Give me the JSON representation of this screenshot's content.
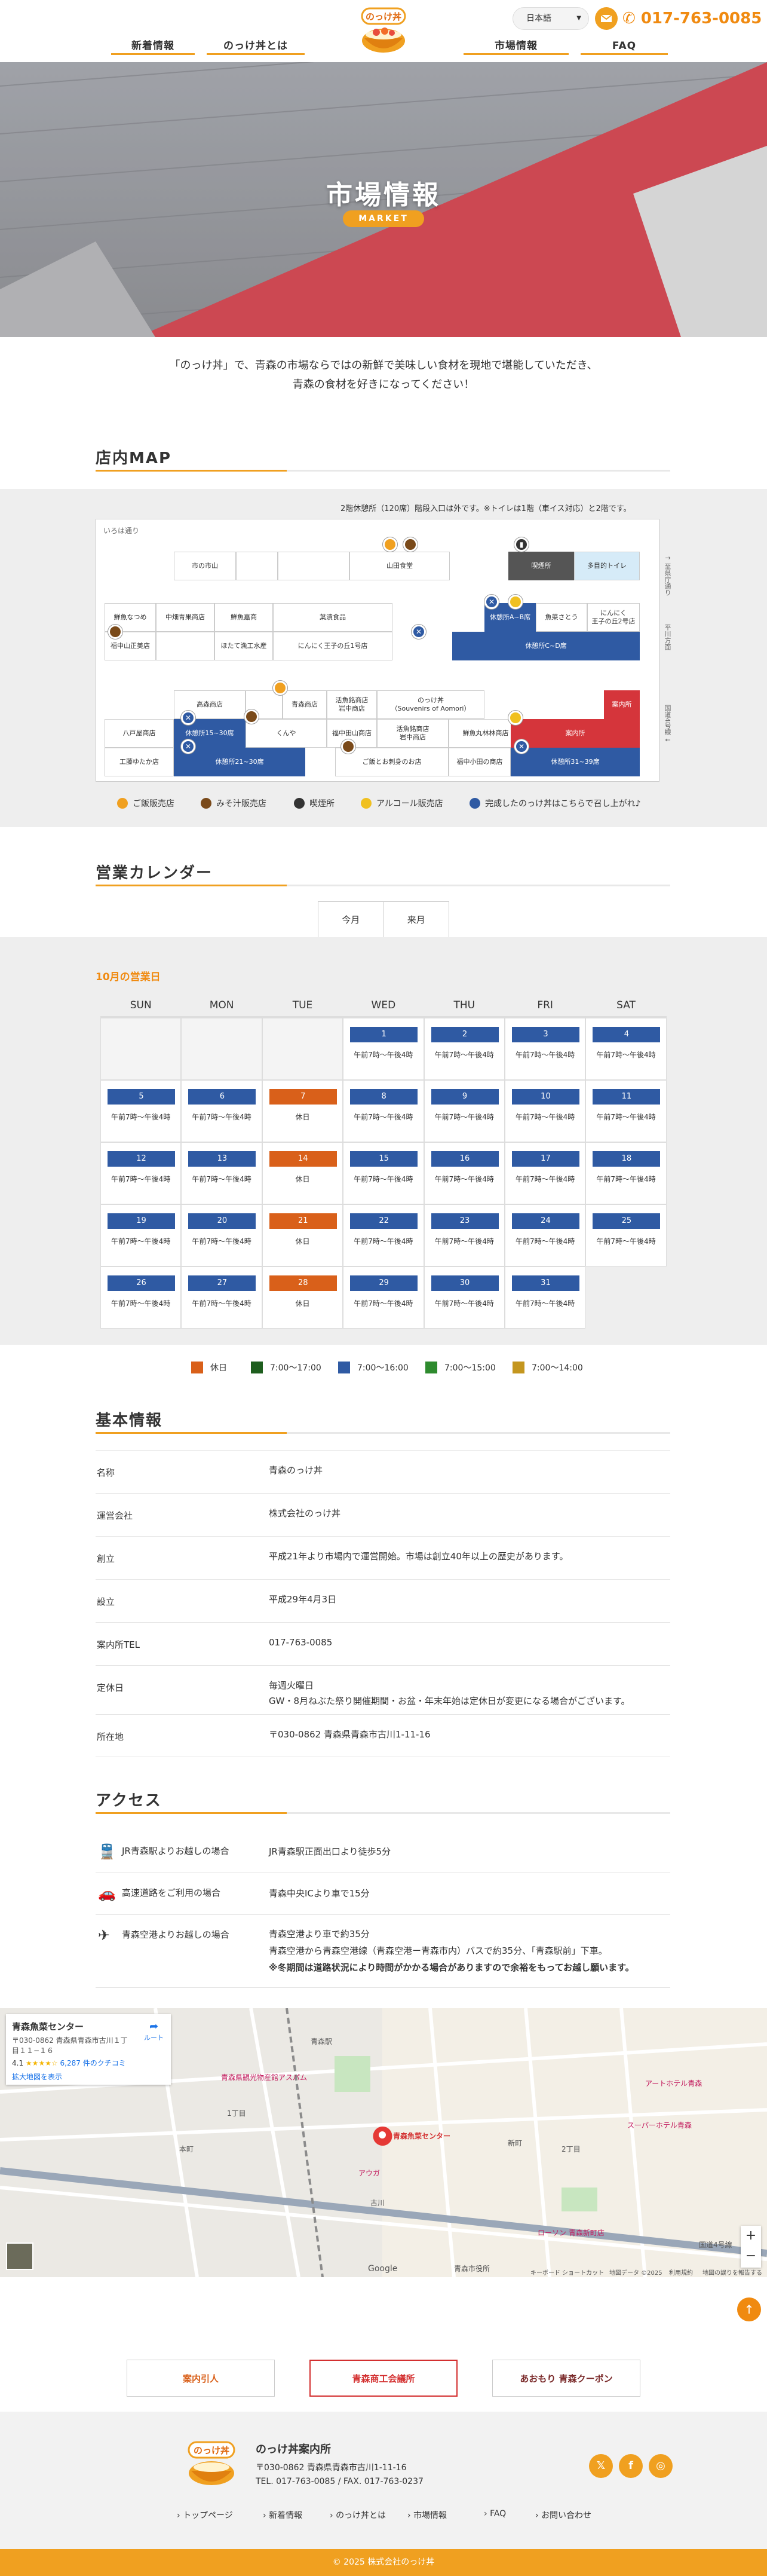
{
  "header": {
    "nav": [
      "新着情報",
      "のっけ丼とは",
      "市場情報",
      "FAQ"
    ],
    "lang": "日本語",
    "tel": "017-763-0085",
    "logo_text": "のっけ丼"
  },
  "hero": {
    "title": "市場情報",
    "badge": "MARKET"
  },
  "intro": {
    "line1": "「のっけ丼」で、青森の市場ならではの新鮮で美味しい食材を現地で堪能していただき、",
    "line2": "青森の食材を好きになってください！"
  },
  "store_map": {
    "title": "店内MAP",
    "note": "2階休憩所（120席）階段入口は外です。※トイレは1階（車イス対応）と2階です。",
    "road_top": "いろは通り",
    "road_right1": "↑ 至県庁通り",
    "road_right2": "平川方面",
    "road_right3": "国道4号線 ↓",
    "cells": [
      "市の市山",
      "山田食堂",
      "喫煙所",
      "多目的トイレ",
      "鮮魚なつめ",
      "中畑青果商店",
      "鮮魚嘉商",
      "葉漬食品",
      "休憩所A~B席",
      "魚菜さとう",
      "にんにく\n王子の丘2号店",
      "福中山正美店",
      "ほたて漁工水産",
      "にんにく王子の丘1号店",
      "休憩所C~D席",
      "高森商店",
      "青森商店",
      "活魚銘商店\n岩中商店",
      "のっけ丼\n（Souvenirs of Aomori）",
      "案内所",
      "八戸屋商店",
      "休憩所15~30席",
      "くんや",
      "福中田山商店",
      "活魚銘商店\n岩中商店",
      "鮮魚丸林林商店",
      "工藤ゆたか店",
      "休憩所21~30席",
      "ご飯とお刺身のお店",
      "福中小田の商店",
      "休憩所31~39席"
    ],
    "legend": [
      "ご飯販売店",
      "みそ汁販売店",
      "喫煙所",
      "アルコール販売店",
      "完成したのっけ丼はこちらで召し上がれ♪"
    ]
  },
  "calendar": {
    "title": "営業カレンダー",
    "tabs": [
      "今月",
      "来月"
    ],
    "month_title": "10月の営業日",
    "weekdays": [
      "SUN",
      "MON",
      "TUE",
      "WED",
      "THU",
      "FRI",
      "SAT"
    ],
    "days": [
      {
        "d": "1",
        "h": "午前7時〜午後4時",
        "c": "#2f5aa3"
      },
      {
        "d": "2",
        "h": "午前7時〜午後4時",
        "c": "#2f5aa3"
      },
      {
        "d": "3",
        "h": "午前7時〜午後4時",
        "c": "#2f5aa3"
      },
      {
        "d": "4",
        "h": "午前7時〜午後4時",
        "c": "#2f5aa3"
      },
      {
        "d": "5",
        "h": "午前7時〜午後4時",
        "c": "#2f5aa3"
      },
      {
        "d": "6",
        "h": "午前7時〜午後4時",
        "c": "#2f5aa3"
      },
      {
        "d": "7",
        "h": "休日",
        "c": "#d9601a"
      },
      {
        "d": "8",
        "h": "午前7時〜午後4時",
        "c": "#2f5aa3"
      },
      {
        "d": "9",
        "h": "午前7時〜午後4時",
        "c": "#2f5aa3"
      },
      {
        "d": "10",
        "h": "午前7時〜午後4時",
        "c": "#2f5aa3"
      },
      {
        "d": "11",
        "h": "午前7時〜午後4時",
        "c": "#2f5aa3"
      },
      {
        "d": "12",
        "h": "午前7時〜午後4時",
        "c": "#2f5aa3"
      },
      {
        "d": "13",
        "h": "午前7時〜午後4時",
        "c": "#2f5aa3"
      },
      {
        "d": "14",
        "h": "休日",
        "c": "#d9601a"
      },
      {
        "d": "15",
        "h": "午前7時〜午後4時",
        "c": "#2f5aa3"
      },
      {
        "d": "16",
        "h": "午前7時〜午後4時",
        "c": "#2f5aa3"
      },
      {
        "d": "17",
        "h": "午前7時〜午後4時",
        "c": "#2f5aa3"
      },
      {
        "d": "18",
        "h": "午前7時〜午後4時",
        "c": "#2f5aa3"
      },
      {
        "d": "19",
        "h": "午前7時〜午後4時",
        "c": "#2f5aa3"
      },
      {
        "d": "20",
        "h": "午前7時〜午後4時",
        "c": "#2f5aa3"
      },
      {
        "d": "21",
        "h": "休日",
        "c": "#d9601a"
      },
      {
        "d": "22",
        "h": "午前7時〜午後4時",
        "c": "#2f5aa3"
      },
      {
        "d": "23",
        "h": "午前7時〜午後4時",
        "c": "#2f5aa3"
      },
      {
        "d": "24",
        "h": "午前7時〜午後4時",
        "c": "#2f5aa3"
      },
      {
        "d": "25",
        "h": "午前7時〜午後4時",
        "c": "#2f5aa3"
      },
      {
        "d": "26",
        "h": "午前7時〜午後4時",
        "c": "#2f5aa3"
      },
      {
        "d": "27",
        "h": "午前7時〜午後4時",
        "c": "#2f5aa3"
      },
      {
        "d": "28",
        "h": "休日",
        "c": "#d9601a"
      },
      {
        "d": "29",
        "h": "午前7時〜午後4時",
        "c": "#2f5aa3"
      },
      {
        "d": "30",
        "h": "午前7時〜午後4時",
        "c": "#2f5aa3"
      },
      {
        "d": "31",
        "h": "午前7時〜午後4時",
        "c": "#2f5aa3"
      }
    ],
    "legend": [
      {
        "label": "休日",
        "c": "#d9601a"
      },
      {
        "label": "7:00〜17:00",
        "c": "#1e5e1e"
      },
      {
        "label": "7:00〜16:00",
        "c": "#2f5aa3"
      },
      {
        "label": "7:00〜15:00",
        "c": "#2e8b2e"
      },
      {
        "label": "7:00〜14:00",
        "c": "#c4961e"
      }
    ]
  },
  "basic": {
    "title": "基本情報",
    "rows": [
      {
        "k": "名称",
        "v": "青森のっけ丼"
      },
      {
        "k": "運営会社",
        "v": "株式会社のっけ丼"
      },
      {
        "k": "創立",
        "v": "平成21年より市場内で運営開始。市場は創立40年以上の歴史があります。"
      },
      {
        "k": "設立",
        "v": "平成29年4月3日"
      },
      {
        "k": "案内所TEL",
        "v": "017-763-0085"
      },
      {
        "k": "定休日",
        "v": "毎週火曜日",
        "v2": "GW・8月ねぶた祭り開催期間・お盆・年末年始は定休日が変更になる場合がございます。"
      },
      {
        "k": "所在地",
        "v": "〒030-0862 青森県青森市古川1-11-16"
      }
    ]
  },
  "access": {
    "title": "アクセス",
    "rows": [
      {
        "k": "JR青森駅よりお越しの場合",
        "v": "JR青森駅正面出口より徒歩5分"
      },
      {
        "k": "高速道路をご利用の場合",
        "v": "青森中央ICより車で15分"
      },
      {
        "k": "青森空港よりお越しの場合",
        "v": "青森空港より車で約35分",
        "v2": "青森空港から青森空港線（青森空港ー青森市内）バスで約35分、「青森駅前」下車。",
        "v3": "※冬期間は道路状況により時間がかかる場合がありますので余裕をもってお越し願います。"
      }
    ]
  },
  "gmap": {
    "card_title": "青森魚菜センター",
    "card_addr": "〒030-0862 青森県青森市古川１丁目１１−１６",
    "card_rating": "4.1",
    "card_reviews": "6,287 件のクチコミ",
    "card_link": "拡大地図を表示",
    "route": "ルート",
    "pin_label": "青森魚菜センター",
    "labels": [
      "青森駅",
      "アートホテル青森",
      "青森県観光物産館アスパム",
      "新町",
      "1丁目",
      "2丁目",
      "古川",
      "本町",
      "国道4号線",
      "ローソン 青森新町店",
      "スーパーホテル青森",
      "青森市役所",
      "アウガ"
    ],
    "credit": "Google",
    "keys": "キーボード ショートカット",
    "mapdata": "地図データ ©2025",
    "terms": "利用規約",
    "report": "地図の誤りを報告する"
  },
  "banners": [
    "案内引人",
    "青森商工会議所",
    "あおもり 青森クーポン"
  ],
  "footer": {
    "name": "のっけ丼案内所",
    "addr": "〒030-0862 青森県青森市古川1-11-16",
    "tel": "TEL. 017-763-0085 / FAX. 017-763-0237",
    "nav": [
      "トップページ",
      "新着情報",
      "のっけ丼とは",
      "市場情報",
      "FAQ",
      "お問い合わせ"
    ],
    "copyright": "© 2025 株式会社のっけ丼"
  }
}
